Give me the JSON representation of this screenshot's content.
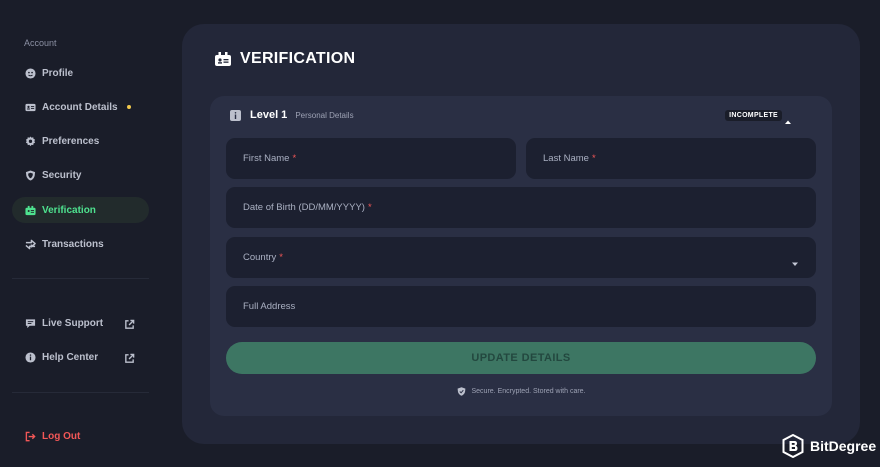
{
  "sidebar": {
    "section_label": "Account",
    "items": [
      {
        "label": "Profile",
        "icon": "profile-icon"
      },
      {
        "label": "Account Details",
        "icon": "id-card-icon"
      },
      {
        "label": "Preferences",
        "icon": "gear-icon"
      },
      {
        "label": "Security",
        "icon": "shield-icon"
      },
      {
        "label": "Verification",
        "icon": "verification-icon",
        "active": true
      },
      {
        "label": "Transactions",
        "icon": "transactions-icon"
      }
    ],
    "support_items": [
      {
        "label": "Live Support",
        "icon": "chat-icon"
      },
      {
        "label": "Help Center",
        "icon": "info-icon"
      }
    ],
    "logout_label": "Log Out"
  },
  "main": {
    "title": "VERIFICATION",
    "level": {
      "label": "Level 1",
      "sublabel": "Personal Details",
      "status": "INCOMPLETE"
    },
    "form": {
      "first_name": {
        "placeholder": "First Name",
        "required": "*"
      },
      "last_name": {
        "placeholder": "Last Name",
        "required": "*"
      },
      "dob": {
        "placeholder": "Date of Birth (DD/MM/YYYY)",
        "required": "*"
      },
      "country": {
        "placeholder": "Country",
        "required": "*"
      },
      "address": {
        "placeholder": "Full Address"
      }
    },
    "submit_label": "UPDATE DETAILS",
    "secure_note": "Secure. Encrypted. Stored with care."
  },
  "watermark": {
    "text": "BitDegree"
  },
  "colors": {
    "background": "#1a1d29",
    "panel": "#232739",
    "card": "#2a2f44",
    "field": "#1c2030",
    "accent": "#4ee28f",
    "button": "#3d7663",
    "required": "#f25757",
    "notice_dot": "#f2c94c"
  }
}
